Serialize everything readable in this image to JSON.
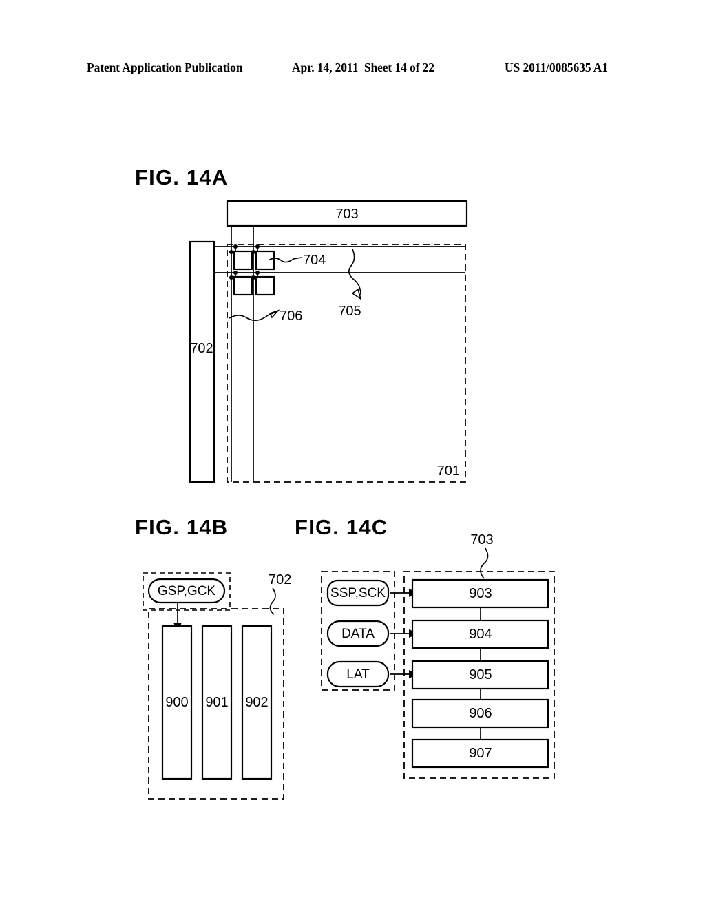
{
  "document": {
    "header": {
      "publication": "Patent Application Publication",
      "date_sheet": "Apr. 14, 2011  Sheet 14 of 22",
      "publication_number": "US 2011/0085635 A1"
    }
  },
  "figures": {
    "fig_a": {
      "title": "FIG. 14A",
      "refs": {
        "pixel_portion": "701",
        "scan_line_driver": "702",
        "signal_line_driver": "703",
        "pixel": "704",
        "scan_line": "705",
        "signal_line": "706"
      }
    },
    "fig_b": {
      "title": "FIG. 14B",
      "input_signal": "GSP,GCK",
      "refs": {
        "driver_block": "702",
        "stage_1": "900",
        "stage_2": "901",
        "stage_3": "902"
      }
    },
    "fig_c": {
      "title": "FIG. 14C",
      "inputs": [
        "SSP,SCK",
        "DATA",
        "LAT"
      ],
      "refs": {
        "driver_block": "703",
        "block_1": "903",
        "block_2": "904",
        "block_3": "905",
        "block_4": "906",
        "block_5": "907"
      }
    }
  },
  "colors": {
    "ink": "#000000",
    "paper": "#ffffff"
  }
}
